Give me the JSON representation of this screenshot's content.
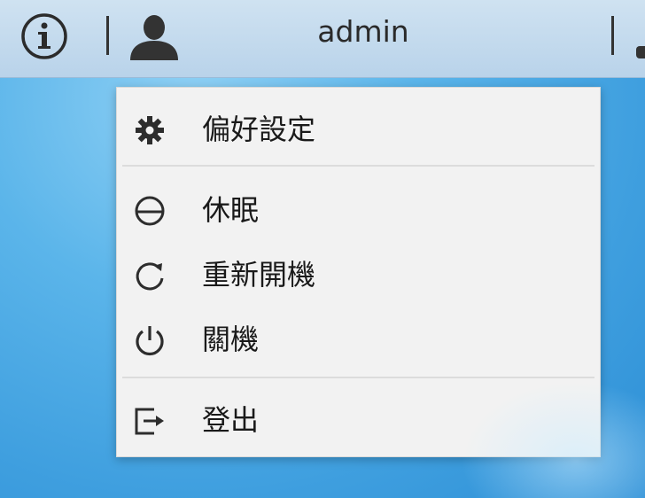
{
  "topbar": {
    "username": "admin",
    "icons": [
      "info-icon",
      "user-icon"
    ]
  },
  "menu": {
    "items": [
      {
        "label": "偏好設定",
        "icon": "gear-icon"
      },
      {
        "label": "休眠",
        "icon": "sleep-icon"
      },
      {
        "label": "重新開機",
        "icon": "restart-icon"
      },
      {
        "label": "關機",
        "icon": "power-icon"
      },
      {
        "label": "登出",
        "icon": "logout-icon"
      }
    ]
  }
}
